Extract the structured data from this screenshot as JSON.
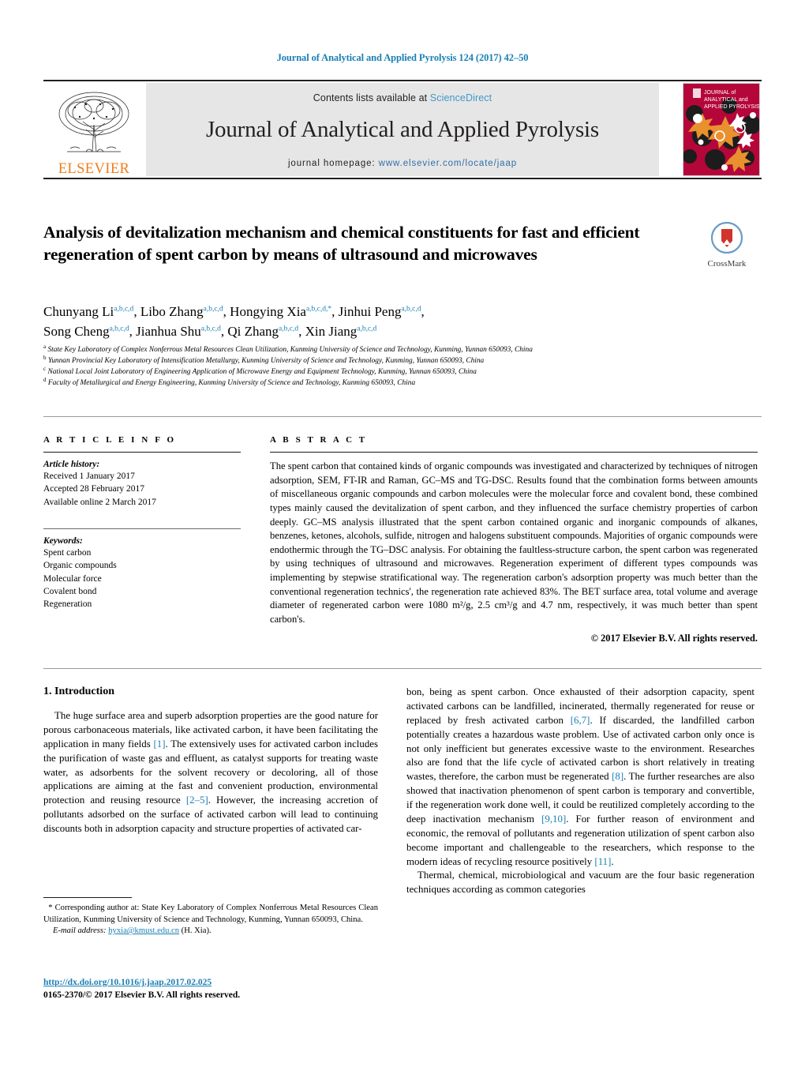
{
  "running_head": "Journal of Analytical and Applied Pyrolysis 124 (2017) 42–50",
  "masthead": {
    "publisher_name": "ELSEVIER",
    "contents_prefix": "Contents lists available at ",
    "contents_link": "ScienceDirect",
    "journal_name": "Journal of Analytical and Applied Pyrolysis",
    "homepage_prefix": "journal homepage: ",
    "homepage_url": "www.elsevier.com/locate/jaap",
    "cover_line1": "JOURNAL of",
    "cover_line2": "ANALYTICAL and",
    "cover_line3": "APPLIED PYROLYSIS"
  },
  "article": {
    "title": "Analysis of devitalization mechanism and chemical constituents for fast and efficient regeneration of spent carbon by means of ultrasound and microwaves",
    "crossmark_label": "CrossMark",
    "authors_line1_parts": [
      {
        "name": "Chunyang Li",
        "sup": "a,b,c,d",
        "star": false,
        "sep": ", "
      },
      {
        "name": "Libo Zhang",
        "sup": "a,b,c,d",
        "star": false,
        "sep": ", "
      },
      {
        "name": "Hongying Xia",
        "sup": "a,b,c,d,",
        "star": true,
        "sep": ", "
      },
      {
        "name": "Jinhui Peng",
        "sup": "a,b,c,d",
        "star": false,
        "sep": ","
      }
    ],
    "authors_line2_parts": [
      {
        "name": "Song Cheng",
        "sup": "a,b,c,d",
        "star": false,
        "sep": ", "
      },
      {
        "name": "Jianhua Shu",
        "sup": "a,b,c,d",
        "star": false,
        "sep": ", "
      },
      {
        "name": "Qi Zhang",
        "sup": "a,b,c,d",
        "star": false,
        "sep": ", "
      },
      {
        "name": "Xin Jiang",
        "sup": "a,b,c,d",
        "star": false,
        "sep": ""
      }
    ],
    "affiliations": [
      {
        "marker": "a",
        "text": "State Key Laboratory of Complex Nonferrous Metal Resources Clean Utilization, Kunming University of Science and Technology, Kunming, Yunnan 650093, China"
      },
      {
        "marker": "b",
        "text": "Yunnan Provincial Key Laboratory of Intensification Metallurgy, Kunming University of Science and Technology, Kunming, Yunnan 650093, China"
      },
      {
        "marker": "c",
        "text": "National Local Joint Laboratory of Engineering Application of Microwave Energy and Equipment Technology, Kunming, Yunnan 650093, China"
      },
      {
        "marker": "d",
        "text": "Faculty of Metallurgical and Energy Engineering, Kunming University of Science and Technology, Kunming 650093, China"
      }
    ]
  },
  "article_info": {
    "heading": "A R T I C L E     I N F O",
    "history_label": "Article history:",
    "history": [
      "Received 1 January 2017",
      "Accepted 28 February 2017",
      "Available online 2 March 2017"
    ],
    "keywords_label": "Keywords:",
    "keywords": [
      "Spent carbon",
      "Organic compounds",
      "Molecular force",
      "Covalent bond",
      "Regeneration"
    ]
  },
  "abstract": {
    "heading": "A B S T R A C T",
    "text": "The spent carbon that contained kinds of organic compounds was investigated and characterized by techniques of nitrogen adsorption, SEM, FT-IR and Raman, GC–MS and TG-DSC. Results found that the combination forms between amounts of miscellaneous organic compounds and carbon molecules were the molecular force and covalent bond, these combined types mainly caused the devitalization of spent carbon, and they influenced the surface chemistry properties of carbon deeply. GC–MS analysis illustrated that the spent carbon contained organic and inorganic compounds of alkanes, benzenes, ketones, alcohols, sulfide, nitrogen and halogens substituent compounds. Majorities of organic compounds were endothermic through the TG–DSC analysis. For obtaining the faultless-structure carbon, the spent carbon was regenerated by using techniques of ultrasound and microwaves. Regeneration experiment of different types compounds was implementing by stepwise stratificational way. The regeneration carbon's adsorption property was much better than the conventional regeneration technics', the regeneration rate achieved 83%. The BET surface area, total volume and average diameter of regenerated carbon were 1080 m²/g, 2.5 cm³/g and 4.7 nm, respectively, it was much better than spent carbon's.",
    "copyright": "© 2017 Elsevier B.V. All rights reserved."
  },
  "body": {
    "section_number_title": "1. Introduction",
    "left_paragraph_1_a": "The huge surface area and superb adsorption properties are the good nature for porous carbonaceous materials, like activated carbon, it have been facilitating the application in many fields ",
    "left_ref_1": "[1]",
    "left_paragraph_1_b": ". The extensively uses for activated carbon includes the purification of waste gas and effluent, as catalyst supports for treating waste water, as adsorbents for the solvent recovery or decoloring, all of those applications are aiming at the fast and convenient production, environmental protection and reusing resource ",
    "left_ref_2": "[2–5]",
    "left_paragraph_1_c": ". However, the increasing accretion of pollutants adsorbed on the surface of activated carbon will lead to continuing discounts both in adsorption capacity and structure properties of activated car-",
    "right_p1_a": "bon, being as spent carbon. Once exhausted of their adsorption capacity, spent activated carbons can be landfilled, incinerated, thermally regenerated for reuse or replaced by fresh activated carbon ",
    "right_ref_1": "[6,7]",
    "right_p1_b": ". If discarded, the landfilled carbon potentially creates a hazardous waste problem. Use of activated carbon only once is not only inefficient but generates excessive waste to the environment. Researches also are fond that the life cycle of activated carbon is short relatively in treating wastes, therefore, the carbon must be regenerated ",
    "right_ref_2": "[8]",
    "right_p1_c": ". The further researches are also showed that inactivation phenomenon of spent carbon is temporary and convertible, if the regeneration work done well, it could be reutilized completely according to the deep inactivation mechanism ",
    "right_ref_3": "[9,10]",
    "right_p1_d": ". For further reason of environment and economic, the removal of pollutants and regeneration utilization of spent carbon also become important and challengeable to the researchers, which response to the modern ideas of recycling resource positively ",
    "right_ref_4": "[11]",
    "right_p1_e": ".",
    "right_p2": "Thermal, chemical, microbiological and vacuum are the four basic regeneration techniques according as common categories"
  },
  "footnote": {
    "star": "*",
    "corresponding_text": " Corresponding author at: State Key Laboratory of Complex Nonferrous Metal Resources Clean Utilization, Kunming University of Science and Technology, Kunming, Yunnan 650093, China.",
    "email_label": "E-mail address:",
    "email": "hyxia@kmust.edu.cn",
    "email_owner": "(H. Xia)."
  },
  "footer": {
    "doi": "http://dx.doi.org/10.1016/j.jaap.2017.02.025",
    "issn_copyright": "0165-2370/© 2017 Elsevier B.V. All rights reserved."
  },
  "colors": {
    "link_blue": "#1a7fb5",
    "sciencedirect_blue": "#3f9ac9",
    "elsevier_orange": "#ef7d1a",
    "cover_red": "#b5063a",
    "band_grey": "#e6e6e6"
  }
}
